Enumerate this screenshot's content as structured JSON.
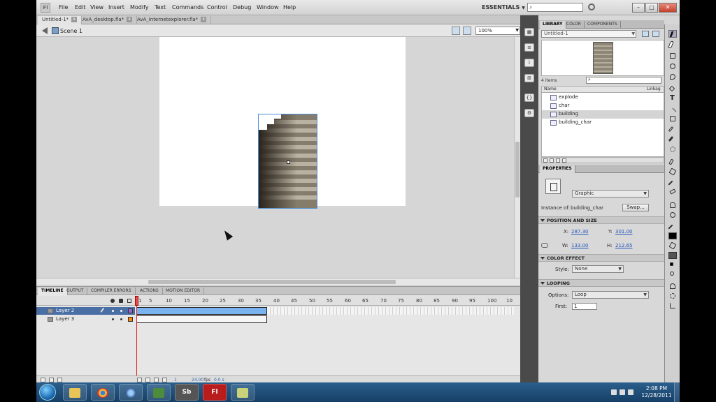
{
  "menubar": {
    "items": [
      "File",
      "Edit",
      "View",
      "Insert",
      "Modify",
      "Text",
      "Commands",
      "Control",
      "Debug",
      "Window",
      "Help"
    ],
    "workspace": "ESSENTIALS"
  },
  "doc_tabs": [
    {
      "label": "Untitled-1*"
    },
    {
      "label": "AvA_desktop.fla*"
    },
    {
      "label": "AvA_internetexplorer.fla*"
    }
  ],
  "editbar": {
    "scene": "Scene 1",
    "zoom": "100%"
  },
  "timeline": {
    "tabs": [
      "TIMELINE",
      "OUTPUT",
      "COMPILER ERRORS",
      "ACTIONS",
      "MOTION EDITOR"
    ],
    "frame_numbers": [
      "1",
      "5",
      "10",
      "15",
      "20",
      "25",
      "30",
      "35",
      "40",
      "45",
      "50",
      "55",
      "60",
      "65",
      "70",
      "75",
      "80",
      "85",
      "90",
      "95",
      "100",
      "10"
    ],
    "layers": [
      {
        "name": "Layer 2",
        "selected": true,
        "color": "#9966cc"
      },
      {
        "name": "Layer 3",
        "selected": false,
        "color": "#ff8800"
      }
    ],
    "footer": {
      "frame": "1",
      "fps": "24.00",
      "fps_unit": "fps",
      "time": "0.0 s"
    }
  },
  "library": {
    "tabs": [
      "LIBRARY",
      "COLOR",
      "COMPONENTS"
    ],
    "document": "Untitled-1",
    "count": "4 items",
    "col_name": "Name",
    "col_linkage": "Linkag",
    "items": [
      "explode",
      "char",
      "building",
      "building_char"
    ],
    "selected_index": 2
  },
  "properties": {
    "tab": "PROPERTIES",
    "symbol_type": "Graphic",
    "instance_label": "Instance of:",
    "instance_name": "building_char",
    "swap": "Swap...",
    "section_position": "POSITION AND SIZE",
    "x_label": "X:",
    "x": "287.30",
    "y_label": "Y:",
    "y": "301.00",
    "w_label": "W:",
    "w": "133.00",
    "h_label": "H:",
    "h": "212.65",
    "section_color": "COLOR EFFECT",
    "style_label": "Style:",
    "style": "None",
    "section_looping": "LOOPING",
    "options_label": "Options:",
    "options": "Loop",
    "first_label": "First:",
    "first": "1"
  },
  "taskbar": {
    "apps": [
      "folder",
      "chrome",
      "itunes",
      "camtasia",
      "Sb",
      "Fl",
      "notes"
    ],
    "time": "2:08 PM",
    "date": "12/28/2011"
  }
}
